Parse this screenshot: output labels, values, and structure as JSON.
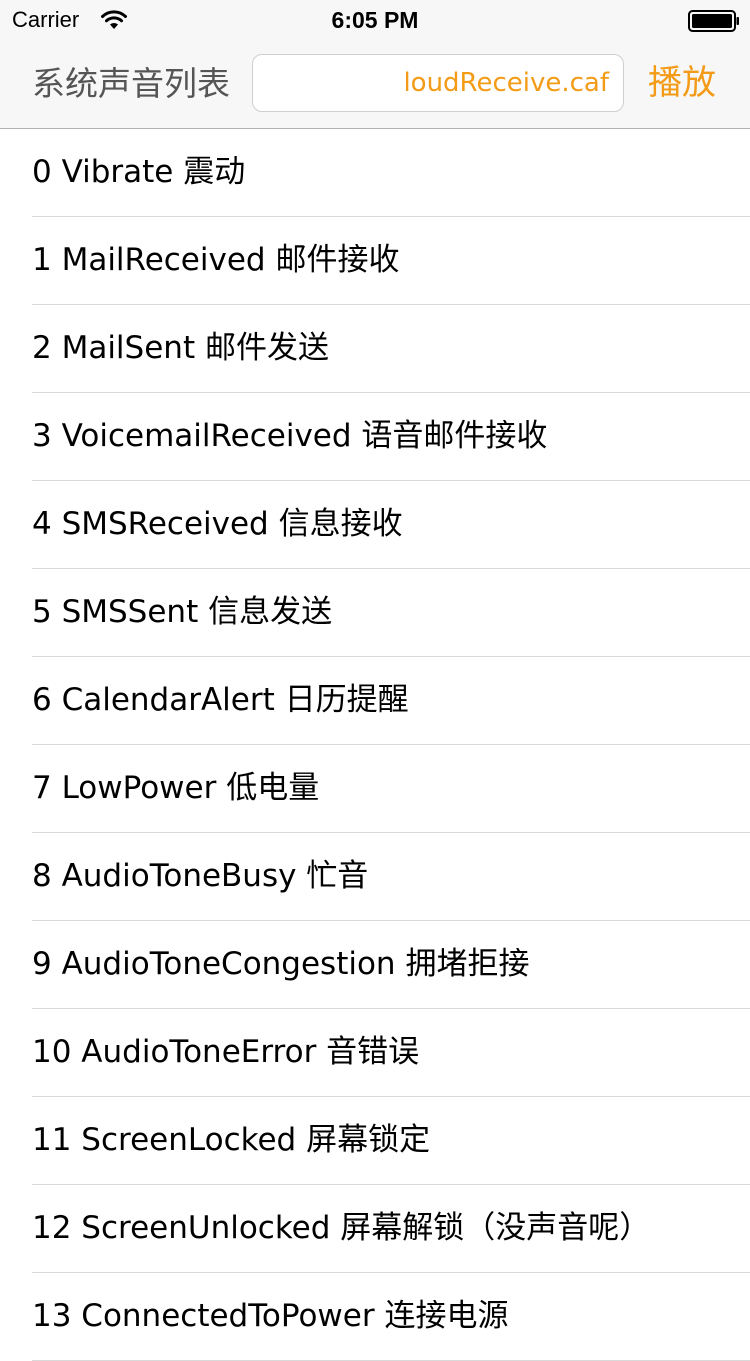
{
  "status_bar": {
    "carrier": "Carrier",
    "time": "6:05 PM",
    "wifi_icon": "wifi-icon",
    "battery_icon": "battery-icon"
  },
  "nav_bar": {
    "title": "系统声音列表",
    "sound_field_value": "loudReceive.caf",
    "play_label": "播放",
    "accent_color": "#f39b16"
  },
  "sound_list": [
    {
      "label": "0 Vibrate 震动"
    },
    {
      "label": "1 MailReceived 邮件接收"
    },
    {
      "label": "2 MailSent 邮件发送"
    },
    {
      "label": "3 VoicemailReceived 语音邮件接收"
    },
    {
      "label": "4 SMSReceived 信息接收"
    },
    {
      "label": "5 SMSSent 信息发送"
    },
    {
      "label": "6 CalendarAlert 日历提醒"
    },
    {
      "label": "7 LowPower 低电量"
    },
    {
      "label": "8 AudioToneBusy 忙音"
    },
    {
      "label": "9 AudioToneCongestion 拥堵拒接"
    },
    {
      "label": "10 AudioToneError 音错误"
    },
    {
      "label": "11 ScreenLocked 屏幕锁定"
    },
    {
      "label": "12 ScreenUnlocked 屏幕解锁（没声音呢）"
    },
    {
      "label": "13 ConnectedToPower 连接电源"
    }
  ]
}
